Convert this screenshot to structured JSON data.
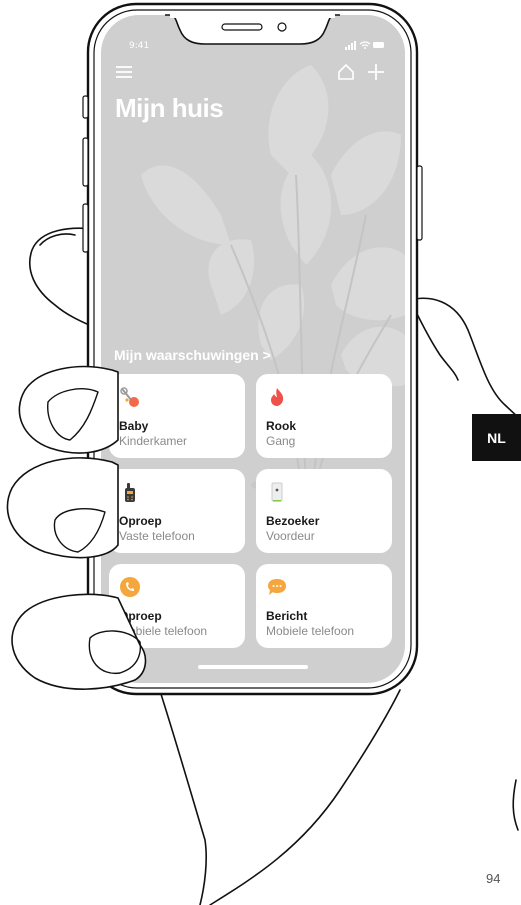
{
  "status": {
    "time": "9:41"
  },
  "header": {
    "title": "Mijn huis",
    "icons": {
      "menu": "menu-icon",
      "home": "home-icon",
      "add": "plus-icon"
    }
  },
  "alerts": {
    "section_title": "Mijn waarschuwingen >",
    "cards": [
      {
        "title": "Baby",
        "subtitle": "Kinderkamer",
        "icon": "baby-monitor-icon"
      },
      {
        "title": "Rook",
        "subtitle": "Gang",
        "icon": "flame-icon"
      },
      {
        "title": "Oproep",
        "subtitle": "Vaste telefoon",
        "icon": "landline-phone-icon"
      },
      {
        "title": "Bezoeker",
        "subtitle": "Voordeur",
        "icon": "doorbell-icon"
      },
      {
        "title": "Oproep",
        "subtitle": "Mobiele telefoon",
        "icon": "mobile-call-icon"
      },
      {
        "title": "Bericht",
        "subtitle": "Mobiele telefoon",
        "icon": "message-icon"
      }
    ]
  },
  "language_badge": "NL",
  "page_number": "94",
  "colors": {
    "screen_bg": "#cfcfcf",
    "card_bg": "#ffffff",
    "flame": "#f0504a",
    "call_orange": "#f5a63c",
    "badge_bg": "#111111"
  }
}
